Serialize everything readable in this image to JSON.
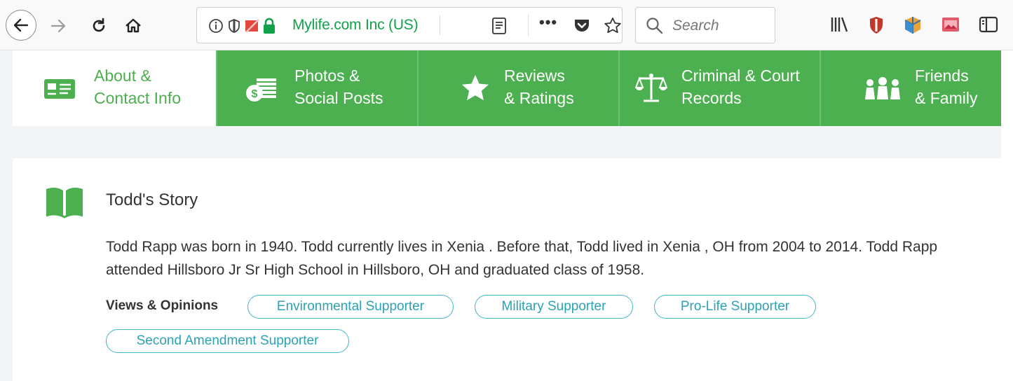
{
  "browser": {
    "identity_text": "Mylife.com Inc (US)",
    "search_placeholder": "Search",
    "more_glyph": "•••"
  },
  "tabs": [
    {
      "label": "About &\nContact Info",
      "icon": "contact-card-icon",
      "active": true
    },
    {
      "label": "Photos &\nSocial Posts",
      "icon": "money-photos-icon",
      "active": false
    },
    {
      "label": "Reviews\n& Ratings",
      "icon": "star-icon",
      "active": false
    },
    {
      "label": "Criminal & Court\nRecords",
      "icon": "scales-icon",
      "active": false
    },
    {
      "label": "Friends\n& Family",
      "icon": "people-icon",
      "active": false
    }
  ],
  "story": {
    "title": "Todd's Story",
    "text": "Todd Rapp was born in 1940. Todd currently lives in Xenia . Before that, Todd lived in Xenia , OH from 2004 to 2014. Todd Rapp attended Hillsboro Jr Sr High School in Hillsboro, OH and graduated class of 1958."
  },
  "views": {
    "label": "Views & Opinions",
    "items": [
      "Environmental Supporter",
      "Military Supporter",
      "Pro-Life Supporter",
      "Second Amendment Supporter"
    ]
  },
  "colors": {
    "brand_green": "#4caf50",
    "pill_teal": "#3fb6c6",
    "url_green": "#12a04a"
  }
}
